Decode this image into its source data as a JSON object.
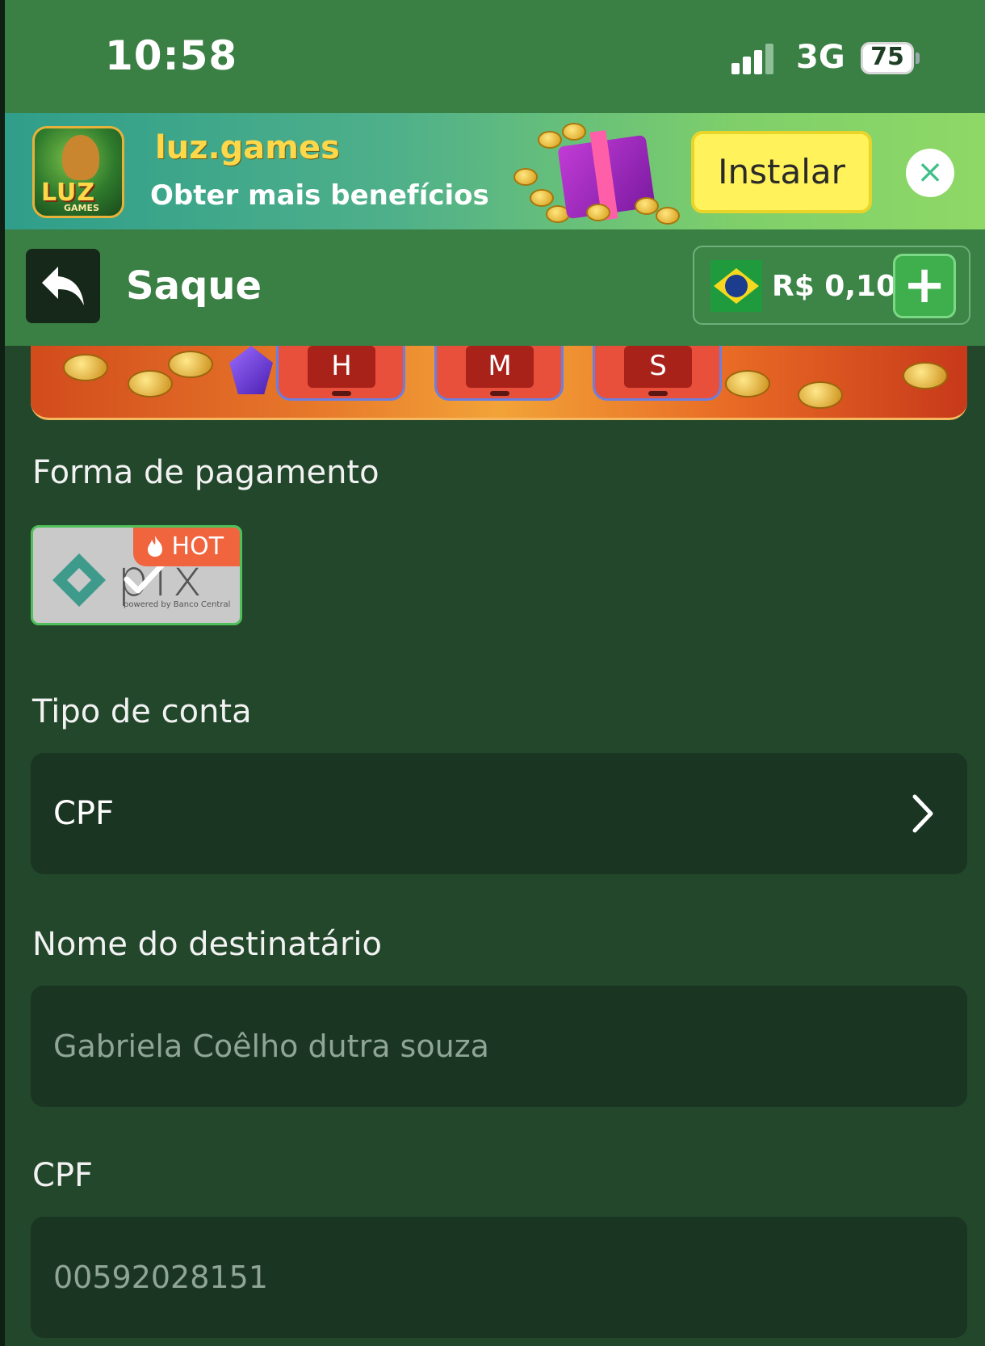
{
  "status_bar": {
    "time": "10:58",
    "network": "3G",
    "battery": "75"
  },
  "install_banner": {
    "app_name": "luz.games",
    "tagline": "Obter mais benefícios",
    "logo_text": "LUZ",
    "logo_sub": "GAMES",
    "install_label": "Instalar",
    "close_icon": "×"
  },
  "header": {
    "title": "Saque",
    "balance": "R$ 0,10",
    "add_label": "+",
    "flag_icon": "brazil-flag-icon"
  },
  "promo": {
    "timers": [
      "H",
      "M",
      "S"
    ]
  },
  "payment": {
    "label": "Forma de pagamento",
    "method": "pix",
    "method_caption": "powered by Banco Central",
    "badge": "HOT"
  },
  "account_type": {
    "label": "Tipo de conta",
    "value": "CPF"
  },
  "recipient": {
    "label": "Nome do destinatário",
    "placeholder": "Gabriela Coêlho dutra souza"
  },
  "cpf": {
    "label": "CPF",
    "placeholder": "00592028151"
  },
  "colors": {
    "header_green": "#3a7f44",
    "body_green": "#22472b",
    "field_bg": "#1b3523",
    "install_yellow": "#fff25a",
    "hot_orange": "#f0643e"
  }
}
